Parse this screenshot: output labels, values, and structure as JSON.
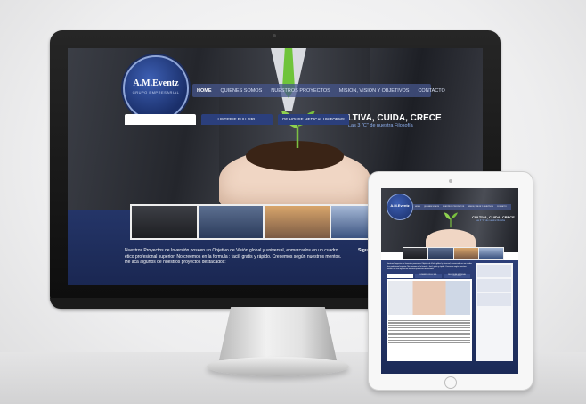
{
  "brand": {
    "name": "A.M.Eventz",
    "subtitle": "GRUPO EMPRESARIAL"
  },
  "nav": {
    "items": [
      {
        "label": "HOME",
        "active": true
      },
      {
        "label": "QUIENES SOMOS"
      },
      {
        "label": "NUESTROS PROYECTOS"
      },
      {
        "label": "MISION, VISION Y OBJETIVOS"
      },
      {
        "label": "CONTACTO"
      }
    ]
  },
  "hero": {
    "headline": "CULTIVA, CUIDA, CRECE",
    "subline": "Las 3 \"C\" de nuestra Filosofía"
  },
  "intro": {
    "text": "Nuestros Proyectos de Inversión poseen un Objetivo de Visión global y universal, enmarcados en un cuadro ético profesional superior. No creemos en la formula : facil, gratis y rápido. Crecemos según nuestros mentos. He aca algunos de nuestros proyectos destacados:",
    "follow": "Sígue"
  },
  "tabs": [
    "",
    "LINGERIE FULL SRL",
    "DE HOUSE MEDICAL UNIFORMS"
  ],
  "colors": {
    "accent": "#2b3f7c",
    "nav": "#46568c",
    "tie": "#6fc43a",
    "tagline_sub": "#8fb1f0"
  }
}
